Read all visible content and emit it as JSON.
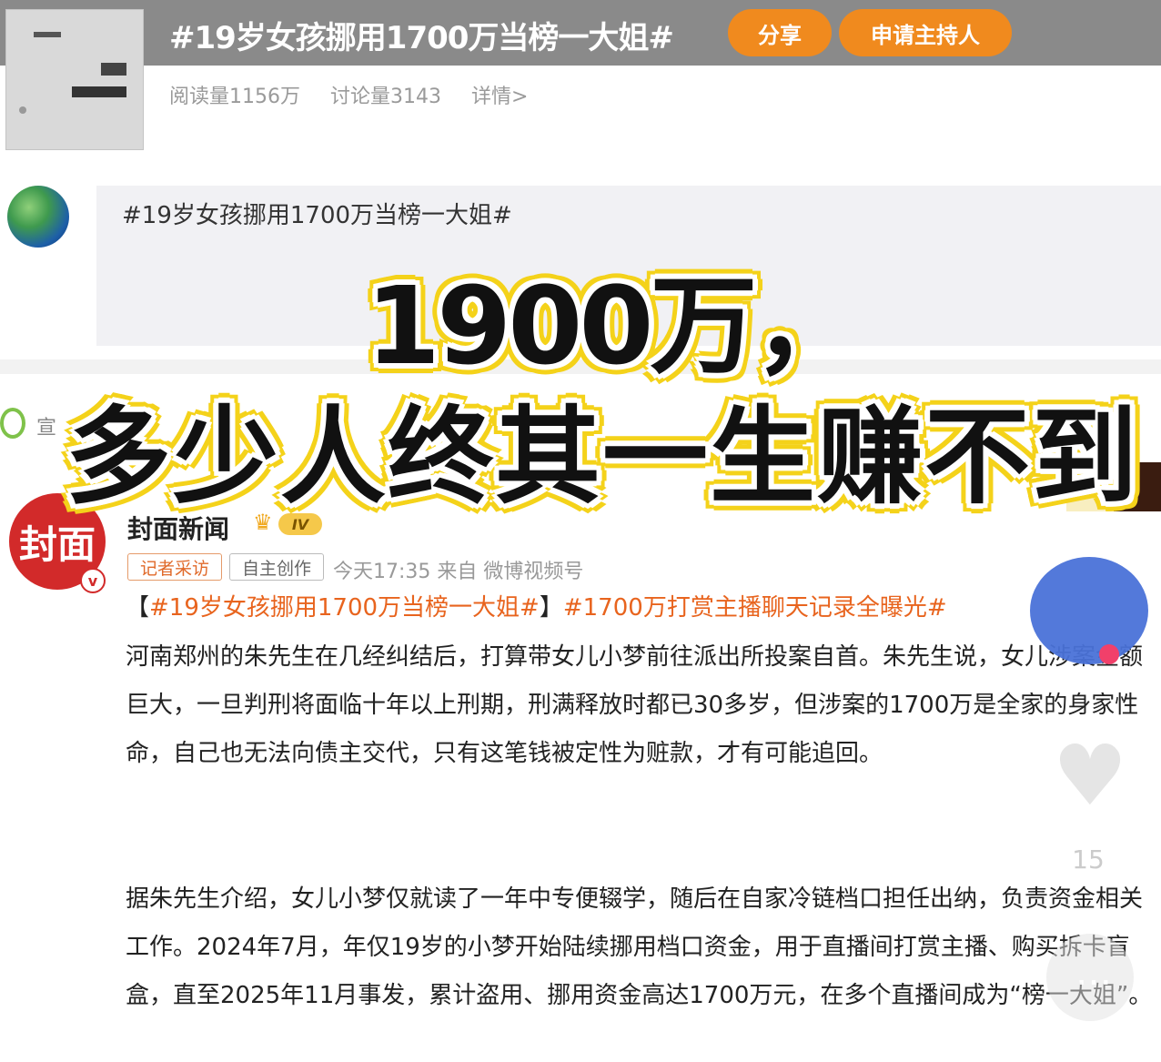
{
  "topic": {
    "title": "#19岁女孩挪用1700万当榜一大姐#",
    "share_label": "分享",
    "apply_host_label": "申请主持人",
    "stats": [
      "阅读量1156万",
      "讨论量3143",
      "详情>"
    ]
  },
  "post": {
    "text": "#19岁女孩挪用1700万当榜一大姐#",
    "peek_label": "宣"
  },
  "caption": {
    "line1": "1900万，",
    "line2": "多少人终其一生赚不到"
  },
  "news": {
    "avatar_text": "封面",
    "verify_mark": "v",
    "author": "封面新闻",
    "level": "IV",
    "tags": [
      "记者采访",
      "自主创作"
    ],
    "meta": "今天17:35  来自 微博视频号",
    "bracket_open": "【",
    "hashtag1": "#19岁女孩挪用1700万当榜一大姐#",
    "bracket_close": "】",
    "hashtag2": "#1700万打赏主播聊天记录全曝光#",
    "paragraph1": "河南郑州的朱先生在几经纠结后，打算带女儿小梦前往派出所投案自首。朱先生说，女儿涉案金额巨大，一旦判刑将面临十年以上刑期，刑满释放时都已30多岁，但涉案的1700万是全家的身家性命，自己也无法向债主交代，只有这笔钱被定性为赃款，才有可能追回。",
    "paragraph2": "据朱先生介绍，女儿小梦仅就读了一年中专便辍学，随后在自家冷链档口担任出纳，负责资金相关工作。2024年7月，年仅19岁的小梦开始陆续挪用档口资金，用于直播间打赏主播、购买拆卡盲盒，直至2025年11月事发，累计盗用、挪用资金高达1700万元，在多个直播间成为“榜一大姐”。"
  },
  "side": {
    "like_count": "15"
  },
  "colors": {
    "accent_orange": "#f08a1e",
    "hashtag_orange": "#e8641e",
    "caption_yellow": "#f4d21a",
    "brand_red": "#d22a2a"
  }
}
